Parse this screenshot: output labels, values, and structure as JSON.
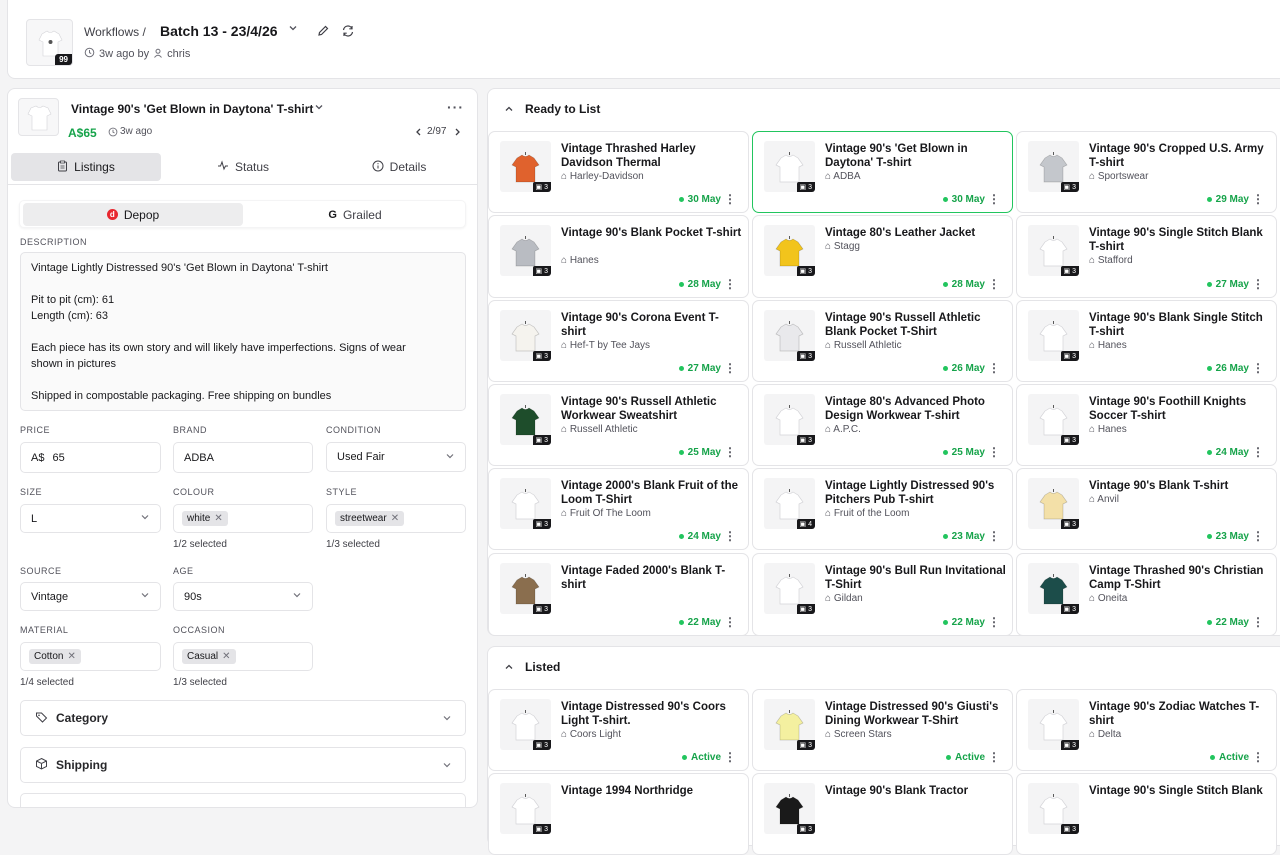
{
  "header": {
    "breadcrumb": "Workflows /",
    "batch_title": "Batch 13 - 23/4/26",
    "batch_count": "99",
    "time_ago": "3w ago by",
    "user": "chris"
  },
  "item": {
    "title": "Vintage 90's 'Get Blown in Daytona' T-shirt",
    "price": "A$65",
    "time_ago": "3w ago",
    "position": "2/97"
  },
  "tabs": [
    "Listings",
    "Status",
    "Details"
  ],
  "platforms": [
    "Depop",
    "Grailed"
  ],
  "form": {
    "description_label": "DESCRIPTION",
    "description_lines": [
      "Vintage Lightly Distressed 90's 'Get Blown in Daytona' T-shirt",
      "",
      "Pit to pit (cm): 61",
      "Length (cm): 63",
      "",
      "Each piece has its own story and will likely have imperfections. Signs of wear",
      "shown in pictures",
      "",
      "Shipped in compostable packaging. Free shipping on bundles"
    ],
    "price_label": "PRICE",
    "price_currency": "A$",
    "price_value": "65",
    "brand_label": "BRAND",
    "brand_value": "ADBA",
    "condition_label": "CONDITION",
    "condition_value": "Used Fair",
    "size_label": "SIZE",
    "size_value": "L",
    "colour_label": "COLOUR",
    "colour_chip": "white",
    "colour_count": "1/2 selected",
    "style_label": "STYLE",
    "style_chip": "streetwear",
    "style_count": "1/3 selected",
    "source_label": "SOURCE",
    "source_value": "Vintage",
    "age_label": "AGE",
    "age_value": "90s",
    "material_label": "MATERIAL",
    "material_chip": "Cotton",
    "material_count": "1/4 selected",
    "occasion_label": "OCCASION",
    "occasion_chip": "Casual",
    "occasion_count": "1/3 selected",
    "category_label": "Category",
    "shipping_label": "Shipping"
  },
  "ready_section": {
    "title": "Ready to List",
    "cards": [
      {
        "title": "Vintage Thrashed Harley Davidson Thermal",
        "brand": "Harley-Davidson",
        "date": "30 May",
        "qty": "3",
        "color": "#e0622d"
      },
      {
        "title": "Vintage 90's 'Get Blown in Daytona' T-shirt",
        "brand": "ADBA",
        "date": "30 May",
        "qty": "3",
        "color": "#ffffff"
      },
      {
        "title": "Vintage 90's Cropped U.S. Army T-shirt",
        "brand": "Sportswear",
        "date": "29 May",
        "qty": "3",
        "color": "#c4c7cc"
      },
      {
        "title": "Vintage 90's Blank Pocket T-shirt",
        "brand": "Hanes",
        "date": "28 May",
        "qty": "3",
        "color": "#b9bcc2"
      },
      {
        "title": "Vintage 80's Leather Jacket",
        "brand": "Stagg",
        "date": "28 May",
        "qty": "3",
        "color": "#f2c41c"
      },
      {
        "title": "Vintage 90's Single Stitch Blank T-shirt",
        "brand": "Stafford",
        "date": "27 May",
        "qty": "3",
        "color": "#ffffff"
      },
      {
        "title": "Vintage 90's Corona Event T-shirt",
        "brand": "Hef-T by Tee Jays",
        "date": "27 May",
        "qty": "3",
        "color": "#f5f3ee"
      },
      {
        "title": "Vintage 90's Russell Athletic Blank Pocket T-Shirt",
        "brand": "Russell Athletic",
        "date": "26 May",
        "qty": "3",
        "color": "#e9e9ec"
      },
      {
        "title": "Vintage 90's Blank Single Stitch T-shirt",
        "brand": "Hanes",
        "date": "26 May",
        "qty": "3",
        "color": "#ffffff"
      },
      {
        "title": "Vintage 90's Russell Athletic Workwear Sweatshirt",
        "brand": "Russell Athletic",
        "date": "25 May",
        "qty": "3",
        "color": "#1e4d2b"
      },
      {
        "title": "Vintage 80's Advanced Photo Design Workwear T-shirt",
        "brand": "A.P.C.",
        "date": "25 May",
        "qty": "3",
        "color": "#ffffff"
      },
      {
        "title": "Vintage 90's Foothill Knights Soccer T-shirt",
        "brand": "Hanes",
        "date": "24 May",
        "qty": "3",
        "color": "#ffffff"
      },
      {
        "title": "Vintage 2000's Blank Fruit of the Loom T-Shirt",
        "brand": "Fruit Of The Loom",
        "date": "24 May",
        "qty": "3",
        "color": "#ffffff"
      },
      {
        "title": "Vintage Lightly Distressed 90's Pitchers Pub T-shirt",
        "brand": "Fruit of the Loom",
        "date": "23 May",
        "qty": "4",
        "color": "#ffffff"
      },
      {
        "title": "Vintage 90's Blank T-shirt",
        "brand": "Anvil",
        "date": "23 May",
        "qty": "3",
        "color": "#f3e0a8"
      },
      {
        "title": "Vintage Faded 2000's Blank T-shirt",
        "brand": "",
        "date": "22 May",
        "qty": "3",
        "color": "#8a6e4e"
      },
      {
        "title": "Vintage 90's Bull Run Invitational T-Shirt",
        "brand": "Gildan",
        "date": "22 May",
        "qty": "3",
        "color": "#ffffff"
      },
      {
        "title": "Vintage Thrashed 90's Christian Camp T-Shirt",
        "brand": "Oneita",
        "date": "22 May",
        "qty": "3",
        "color": "#1c4d4a"
      }
    ]
  },
  "listed_section": {
    "title": "Listed",
    "cards": [
      {
        "title": "Vintage Distressed 90's Coors Light T-shirt.",
        "brand": "Coors Light",
        "date": "Active",
        "qty": "3",
        "color": "#ffffff"
      },
      {
        "title": "Vintage Distressed 90's Giusti's Dining Workwear T-Shirt",
        "brand": "Screen Stars",
        "date": "Active",
        "qty": "3",
        "color": "#f4f0a0"
      },
      {
        "title": "Vintage 90's Zodiac Watches T-shirt",
        "brand": "Delta",
        "date": "Active",
        "qty": "3",
        "color": "#ffffff"
      },
      {
        "title": "Vintage 1994 Northridge",
        "brand": "",
        "date": "",
        "qty": "3",
        "color": "#ffffff"
      },
      {
        "title": "Vintage 90's Blank Tractor",
        "brand": "",
        "date": "",
        "qty": "3",
        "color": "#1a1a1a"
      },
      {
        "title": "Vintage 90's Single Stitch Blank",
        "brand": "",
        "date": "",
        "qty": "3",
        "color": "#ffffff"
      }
    ]
  }
}
